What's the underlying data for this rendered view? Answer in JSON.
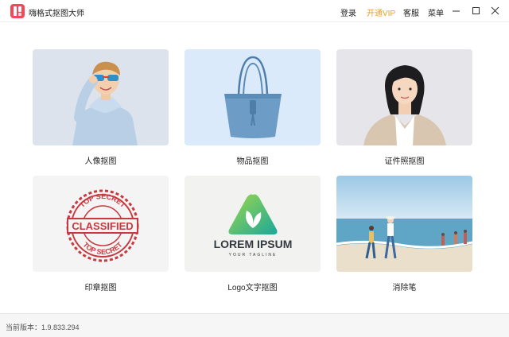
{
  "app": {
    "title": "嗨格式抠图大师",
    "brand_color": "#f2485a",
    "accent_vip_color": "#f29b1c"
  },
  "header": {
    "login_label": "登录",
    "vip_label": "开通VIP",
    "support_label": "客服",
    "menu_label": "菜单"
  },
  "tools": [
    {
      "label": "人像抠图",
      "bg": "#dde3ec"
    },
    {
      "label": "物品抠图",
      "bg": "#dbeafb"
    },
    {
      "label": "证件照抠图",
      "bg": "#e6e5ea"
    },
    {
      "label": "印章抠图",
      "bg": "#f4f4f4"
    },
    {
      "label": "Logo文字抠图",
      "bg": "#f2f2f0"
    },
    {
      "label": "消除笔",
      "bg": "#bcd8ea"
    }
  ],
  "logo_sample": {
    "brand_text": "LOREM IPSUM",
    "tagline": "YOUR TAGLINE"
  },
  "stamp_sample": {
    "arc_top": "TOP SECRET",
    "center": "CLASSIFIED",
    "arc_bottom": "TOP SECRET"
  },
  "status": {
    "version_text": "当前版本：1.9.833.294"
  }
}
